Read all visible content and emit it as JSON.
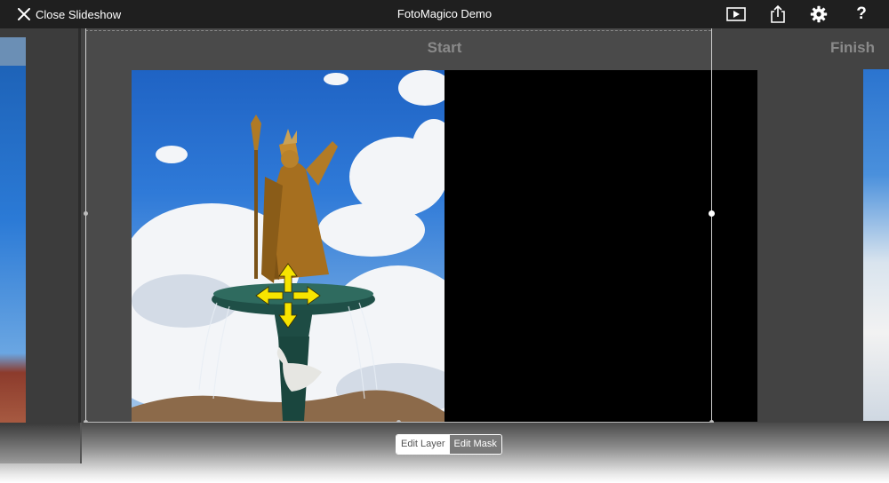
{
  "topbar": {
    "close_label": "Close Slideshow",
    "title": "FotoMagico Demo",
    "icons": [
      "close-icon",
      "play-icon",
      "share-icon",
      "gear-icon",
      "help-icon"
    ],
    "help_glyph": "?"
  },
  "canvas": {
    "start_label": "Start",
    "finish_label": "Finish"
  },
  "mode_toggle": {
    "edit_layer": "Edit Layer",
    "edit_mask": "Edit Mask",
    "selected": "Edit Layer"
  },
  "colors": {
    "topbar_bg": "#1f1f1f",
    "workspace_bg": "#434343",
    "move_arrows": "#f7e400"
  }
}
